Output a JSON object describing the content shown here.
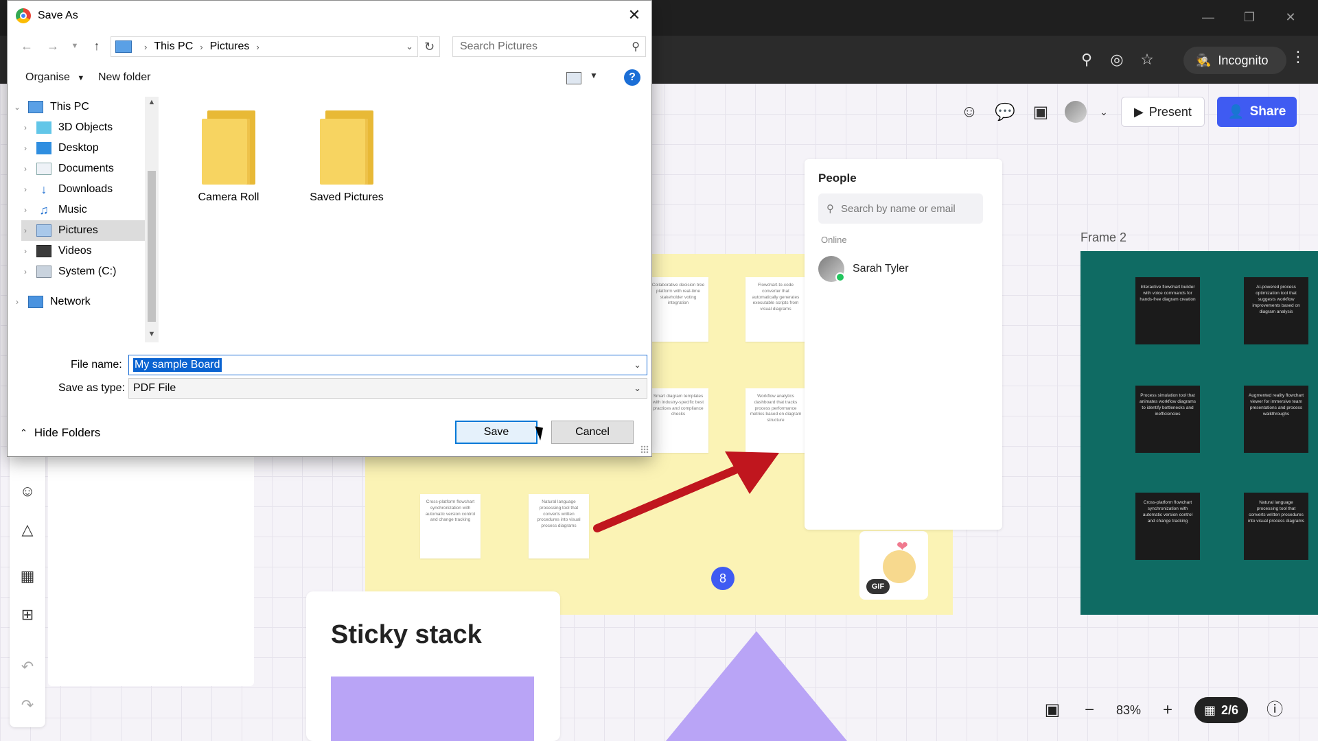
{
  "browser": {
    "incognito_label": "Incognito"
  },
  "app": {
    "present_label": "Present",
    "share_label": "Share",
    "people": {
      "title": "People",
      "search_placeholder": "Search by name or email",
      "online_label": "Online",
      "users": [
        {
          "name": "Sarah Tyler"
        }
      ]
    },
    "frame2_label": "Frame 2",
    "yellow_notes": [
      "Collaborative decision tree platform with real-time stakeholder voting integration",
      "Flowchart-to-code converter that automatically generates executable scripts from visual diagrams",
      "Smart diagram templates with industry-specific best practices and compliance checks",
      "Workflow analytics dashboard that tracks process performance metrics based on diagram structure",
      "Cross-platform flowchart synchronization with automatic version control and change tracking",
      "Natural language processing tool that converts written procedures into visual process diagrams"
    ],
    "teal_notes": [
      "Interactive flowchart builder with voice commands for hands-free diagram creation",
      "AI-powered process optimization tool that suggests workflow improvements based on diagram analysis",
      "Process simulation tool that animates workflow diagrams to identify bottlenecks and inefficiencies",
      "Augmented reality flowchart viewer for immersive team presentations and process walkthroughs",
      "Cross-platform flowchart synchronization with automatic version control and change tracking",
      "Natural language processing tool that converts written procedures into visual process diagrams"
    ],
    "count_bubble": "8",
    "gif_tag": "GIF",
    "sticky_stack_title": "Sticky stack",
    "zoom_level": "83%",
    "page_indicator": "2/6"
  },
  "dialog": {
    "title": "Save As",
    "breadcrumb": [
      "This PC",
      "Pictures"
    ],
    "search_placeholder": "Search Pictures",
    "organise_label": "Organise",
    "new_folder_label": "New folder",
    "tree": [
      {
        "label": "This PC",
        "icon": "pc-icon"
      },
      {
        "label": "3D Objects",
        "icon": "cube-icon"
      },
      {
        "label": "Desktop",
        "icon": "desktop-icon"
      },
      {
        "label": "Documents",
        "icon": "document-icon"
      },
      {
        "label": "Downloads",
        "icon": "download-icon"
      },
      {
        "label": "Music",
        "icon": "music-icon"
      },
      {
        "label": "Pictures",
        "icon": "pictures-icon",
        "selected": true
      },
      {
        "label": "Videos",
        "icon": "video-icon"
      },
      {
        "label": "System (C:)",
        "icon": "drive-icon"
      },
      {
        "label": "Network",
        "icon": "network-icon"
      }
    ],
    "folders": [
      "Camera Roll",
      "Saved Pictures"
    ],
    "file_name_label": "File name:",
    "file_name_value": "My sample Board",
    "save_type_label": "Save as type:",
    "save_type_value": "PDF File",
    "hide_folders_label": "Hide Folders",
    "save_label": "Save",
    "cancel_label": "Cancel"
  }
}
